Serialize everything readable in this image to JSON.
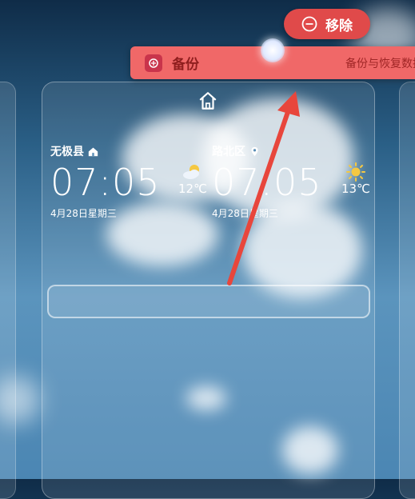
{
  "toolbar": {
    "remove_label": "移除"
  },
  "backup_item": {
    "title": "备份",
    "description": "备份与恢复数据"
  },
  "clocks": [
    {
      "location": "无极县",
      "time": "07:05",
      "date": "4月28日星期三",
      "temperature": "12℃",
      "weather_icon": "partly-cloudy-icon"
    },
    {
      "location": "路北区",
      "time": "07:05",
      "date": "4月28日星期三",
      "temperature": "13℃",
      "weather_icon": "sun-icon"
    }
  ],
  "colors": {
    "remove_button": "#e04a4a",
    "backup_bar": "#f06868",
    "arrow": "#e8463c"
  }
}
